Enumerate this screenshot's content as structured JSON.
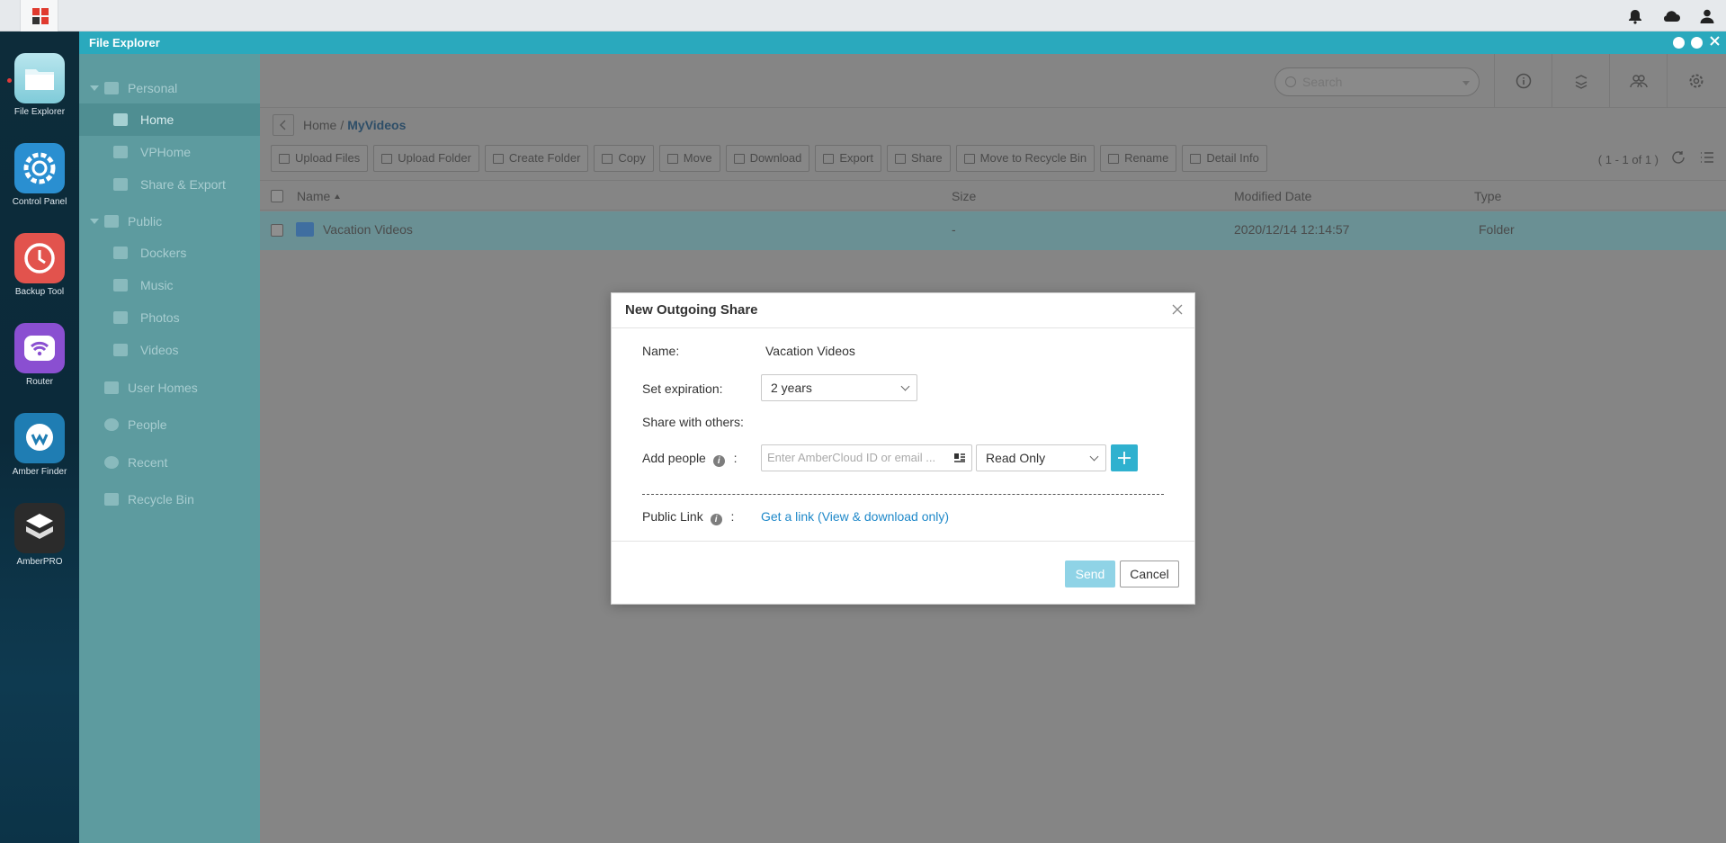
{
  "window": {
    "title": "File Explorer"
  },
  "dock": {
    "items": [
      {
        "label": "File Explorer",
        "icon": "folder-icon"
      },
      {
        "label": "Control Panel",
        "icon": "gear-icon"
      },
      {
        "label": "Backup Tool",
        "icon": "clock-icon"
      },
      {
        "label": "Router",
        "icon": "wifi-icon"
      },
      {
        "label": "Amber Finder",
        "icon": "finder-icon"
      },
      {
        "label": "AmberPRO",
        "icon": "box-icon"
      }
    ]
  },
  "sidebar": {
    "personal": "Personal",
    "home": "Home",
    "vphome": "VPHome",
    "share_export": "Share & Export",
    "public": "Public",
    "dockers": "Dockers",
    "music": "Music",
    "photos": "Photos",
    "videos": "Videos",
    "user_homes": "User Homes",
    "people": "People",
    "recent": "Recent",
    "recycle_bin": "Recycle Bin"
  },
  "search": {
    "placeholder": "Search"
  },
  "breadcrumb": {
    "home": "Home",
    "separator": "/",
    "current": "MyVideos"
  },
  "actions": {
    "upload_files": "Upload Files",
    "upload_folder": "Upload Folder",
    "create_folder": "Create Folder",
    "copy": "Copy",
    "move": "Move",
    "download": "Download",
    "export": "Export",
    "share": "Share",
    "move_recycle": "Move to Recycle Bin",
    "rename": "Rename",
    "detail_info": "Detail Info"
  },
  "pager": {
    "text": "( 1 - 1 of 1 )"
  },
  "table": {
    "headers": {
      "name": "Name",
      "size": "Size",
      "modified": "Modified Date",
      "type": "Type"
    },
    "rows": [
      {
        "name": "Vacation Videos",
        "size": "-",
        "modified": "2020/12/14 12:14:57",
        "type": "Folder"
      }
    ]
  },
  "modal": {
    "title": "New Outgoing Share",
    "name_label": "Name:",
    "name_value": "Vacation Videos",
    "expiration_label": "Set expiration:",
    "expiration_value": "2 years",
    "share_with_label": "Share with others:",
    "add_people_label": "Add people",
    "colon": ":",
    "add_people_placeholder": "Enter AmberCloud ID or email ...",
    "permission_value": "Read Only",
    "public_link_label": "Public Link",
    "public_link_text": "Get a link (View & download only)",
    "send_label": "Send",
    "cancel_label": "Cancel"
  },
  "colors": {
    "title_bar": "#2aa9bd",
    "accent": "#2fb1cf",
    "link": "#1e88c9"
  }
}
